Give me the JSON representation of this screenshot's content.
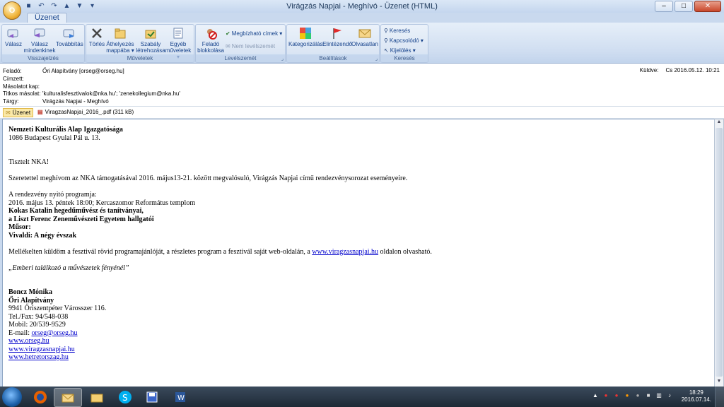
{
  "window": {
    "title": "Virágzás Napjai - Meghívó - Üzenet (HTML)",
    "orb_letter": "O",
    "controls": {
      "minimize": "–",
      "maximize": "□",
      "close": "✕"
    }
  },
  "ribbon": {
    "tab": "Üzenet",
    "groups": {
      "respond": {
        "label": "Visszajelzés",
        "reply": "Válasz",
        "reply_all_1": "Válasz",
        "reply_all_2": "mindenkinek",
        "forward": "Továbbítás"
      },
      "actions": {
        "label": "Műveletek",
        "delete": "Törlés",
        "move_1": "Áthelyezés",
        "move_2": "mappába ▾",
        "rule_1": "Szabály",
        "rule_2": "létrehozása",
        "other_1": "Egyéb",
        "other_2": "műveletek ▾"
      },
      "junk": {
        "label": "Levélszemét",
        "block_1": "Feladó",
        "block_2": "blokkolása",
        "safe": "Megbízható címek ▾",
        "not_junk": "Nem levélszemét"
      },
      "options": {
        "label": "Beállítások",
        "categorize": "Kategorizálás",
        "followup": "Elintézendő",
        "unread": "Olvasatlan"
      },
      "find": {
        "label": "Keresés",
        "find": "Keresés",
        "related": "Kapcsolódó ▾",
        "select": "Kijelölés ▾"
      }
    }
  },
  "headers": {
    "from_label": "Feladó:",
    "from": "Őri Alapítvány [orseg@orseg.hu]",
    "to_label": "Címzett:",
    "cc_label": "Másolatot kap:",
    "bcc_label": "Titkos másolat:",
    "bcc": "'kulturalisfesztivalok@nka.hu'; 'zenekollegium@nka.hu'",
    "subject_label": "Tárgy:",
    "subject": "Virágzás Napjai - Meghívó",
    "sent_label": "Küldve:",
    "sent": "Cs 2016.05.12. 10:21"
  },
  "attachments": {
    "message": "Üzenet",
    "file": "ViragzasNapjai_2016_.pdf (311 kB)"
  },
  "body": {
    "org": "Nemzeti Kulturális Alap Igazgatósága",
    "addr": "1086 Budapest Gyulai Pál u. 13.",
    "greeting": "Tisztelt NKA!",
    "invite": "Szeretettel meghívom az NKA támogatásával 2016. május13-21. között megvalósuló, Virágzás Napjai című rendezvénysorozat eseményeire.",
    "program_title": "A rendezvény nyitó programja:",
    "program_date": "2016. május 13. péntek 18:00; Kercaszomor Református templom",
    "perf1": "Kokas Katalin hegedűművész és tanítványai,",
    "perf2": "a Liszt Ferenc Zeneművészeti Egyetem hallgatói",
    "musor": "Műsor:",
    "vivaldi": "Vivaldi: A négy évszak",
    "attach_pre": "Mellékelten küldöm a fesztivál rövid programajánlóját, a részletes program a fesztivál saját web-oldalán, a ",
    "attach_link": "www.viragzasnapjai.hu",
    "attach_post": " oldalon olvasható.",
    "motto": "„Emberi találkozó a művészetek fényénél”",
    "sig_name": "Boncz Mónika",
    "sig_org": "Őri Alapítvány",
    "sig_addr": "9941 Őriszentpéter Városszer 116.",
    "sig_tel": "Tel./Fax: 94/548-038",
    "sig_mobil": "Mobil: 20/539-9529",
    "sig_email_label": "E-mail: ",
    "sig_email": "orseg@orseg.hu",
    "link1": "www.orseg.hu",
    "link2": "www.viragzasnapjai.hu",
    "link3": "www.hetretorszag.hu"
  },
  "taskbar": {
    "time": "18:29",
    "date": "2016.07.14."
  }
}
